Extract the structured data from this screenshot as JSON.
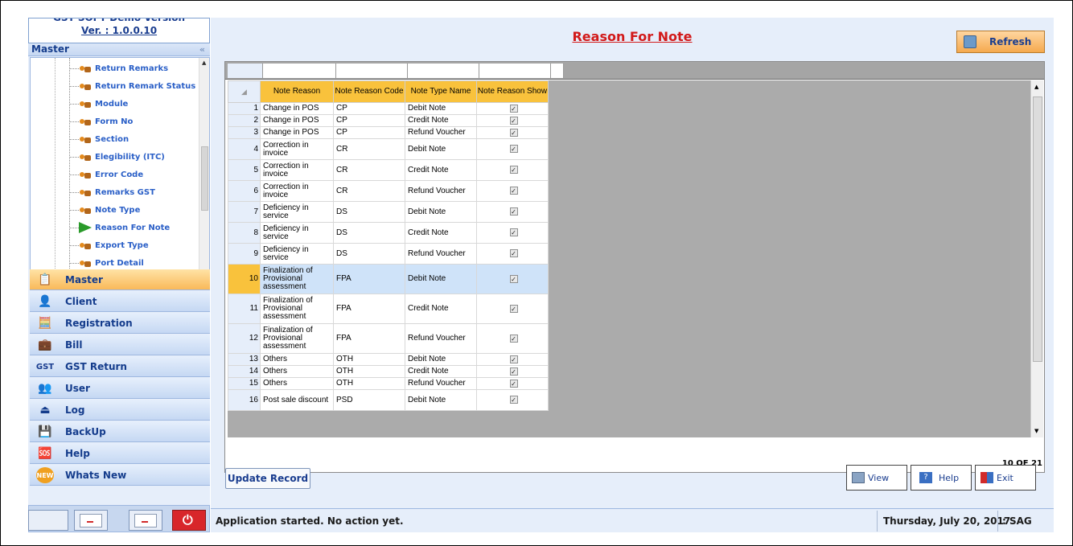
{
  "sidebar": {
    "version_top": "GST SOFT Demo Version",
    "version": "Ver. : 1.0.0.10",
    "header": "Master",
    "tree_items": [
      {
        "label": "Return Remarks"
      },
      {
        "label": "Return Remark Status"
      },
      {
        "label": "Module"
      },
      {
        "label": "Form No"
      },
      {
        "label": "Section"
      },
      {
        "label": "Elegibility (ITC)"
      },
      {
        "label": "Error Code"
      },
      {
        "label": "Remarks GST"
      },
      {
        "label": "Note Type"
      },
      {
        "label": "Reason For Note"
      },
      {
        "label": "Export Type"
      },
      {
        "label": "Port Detail"
      }
    ],
    "nav": [
      {
        "label": "Master"
      },
      {
        "label": "Client"
      },
      {
        "label": "Registration"
      },
      {
        "label": "Bill"
      },
      {
        "label": "GST Return"
      },
      {
        "label": "User"
      },
      {
        "label": "Log"
      },
      {
        "label": "BackUp"
      },
      {
        "label": "Help"
      },
      {
        "label": "Whats New"
      }
    ]
  },
  "main": {
    "title": "Reason For Note",
    "refresh_label": "Refresh",
    "grid": {
      "columns": [
        "Note Reason",
        "Note Reason Code",
        "Note Type Name",
        "Note Reason Show"
      ],
      "rows": [
        {
          "n": "1",
          "reason": "Change in POS",
          "code": "CP",
          "type": "Debit Note"
        },
        {
          "n": "2",
          "reason": "Change in POS",
          "code": "CP",
          "type": "Credit Note"
        },
        {
          "n": "3",
          "reason": "Change in POS",
          "code": "CP",
          "type": "Refund Voucher"
        },
        {
          "n": "4",
          "reason": "Correction in invoice",
          "code": "CR",
          "type": "Debit Note"
        },
        {
          "n": "5",
          "reason": "Correction in invoice",
          "code": "CR",
          "type": "Credit Note"
        },
        {
          "n": "6",
          "reason": "Correction in invoice",
          "code": "CR",
          "type": "Refund Voucher"
        },
        {
          "n": "7",
          "reason": "Deficiency in service",
          "code": "DS",
          "type": "Debit Note"
        },
        {
          "n": "8",
          "reason": "Deficiency in service",
          "code": "DS",
          "type": "Credit Note"
        },
        {
          "n": "9",
          "reason": "Deficiency in service",
          "code": "DS",
          "type": "Refund Voucher"
        },
        {
          "n": "10",
          "reason": "Finalization of Provisional assessment",
          "code": "FPA",
          "type": "Debit Note"
        },
        {
          "n": "11",
          "reason": "Finalization of Provisional assessment",
          "code": "FPA",
          "type": "Credit Note"
        },
        {
          "n": "12",
          "reason": "Finalization of Provisional assessment",
          "code": "FPA",
          "type": "Refund Voucher"
        },
        {
          "n": "13",
          "reason": "Others",
          "code": "OTH",
          "type": "Debit Note"
        },
        {
          "n": "14",
          "reason": "Others",
          "code": "OTH",
          "type": "Credit Note"
        },
        {
          "n": "15",
          "reason": "Others",
          "code": "OTH",
          "type": "Refund Voucher"
        },
        {
          "n": "16",
          "reason": "Post sale discount",
          "code": "PSD",
          "type": "Debit Note"
        }
      ],
      "check_mark": "✓",
      "record_count": "10 OF 21"
    },
    "update_label": "Update Record",
    "view_label": "View",
    "help_label": "Help",
    "exit_label": "Exit"
  },
  "status": {
    "message": "Application started. No action yet.",
    "date": "Thursday, July 20, 2017",
    "user": ": SAG"
  },
  "colors": {
    "header_accent": "#f9c23c",
    "title_red": "#d21a1a",
    "link_blue": "#1a3d8f",
    "selected_row": "#cfe3f9"
  }
}
